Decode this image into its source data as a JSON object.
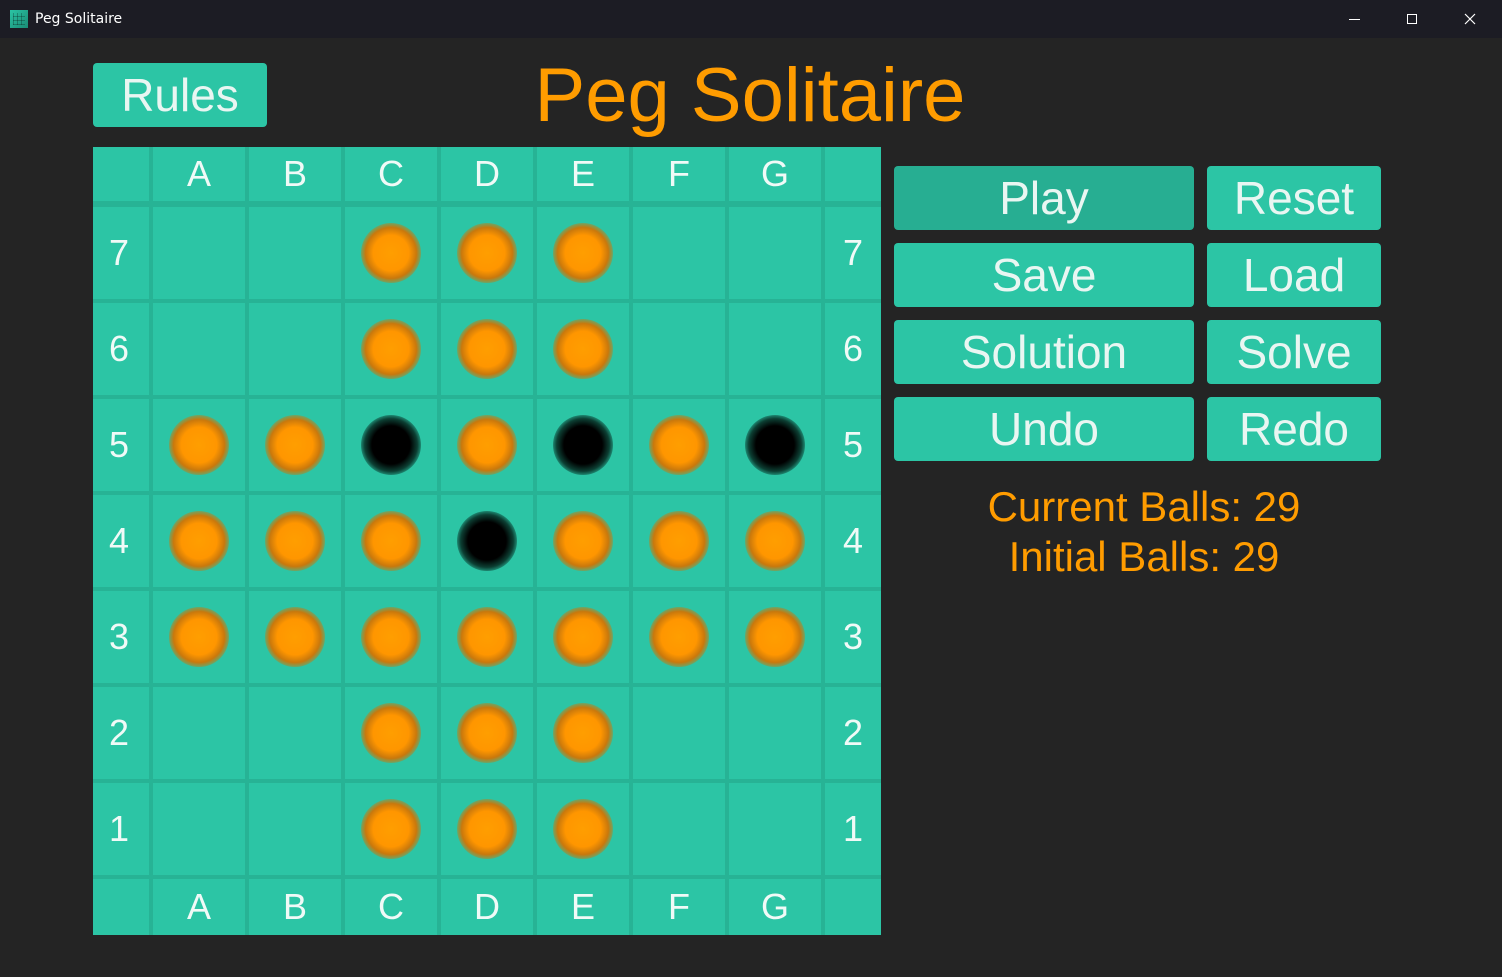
{
  "window": {
    "title": "Peg Solitaire",
    "controls": [
      "minimize-icon",
      "maximize-icon",
      "close-icon"
    ]
  },
  "header": {
    "rules_label": "Rules",
    "title": "Peg Solitaire"
  },
  "board": {
    "columns": [
      "A",
      "B",
      "C",
      "D",
      "E",
      "F",
      "G"
    ],
    "rows": [
      "7",
      "6",
      "5",
      "4",
      "3",
      "2",
      "1"
    ],
    "cells": [
      [
        null,
        null,
        "peg",
        "peg",
        "peg",
        null,
        null
      ],
      [
        null,
        null,
        "peg",
        "peg",
        "peg",
        null,
        null
      ],
      [
        "peg",
        "peg",
        "hole",
        "peg",
        "hole",
        "peg",
        "hole"
      ],
      [
        "peg",
        "peg",
        "peg",
        "hole",
        "peg",
        "peg",
        "peg"
      ],
      [
        "peg",
        "peg",
        "peg",
        "peg",
        "peg",
        "peg",
        "peg"
      ],
      [
        null,
        null,
        "peg",
        "peg",
        "peg",
        null,
        null
      ],
      [
        null,
        null,
        "peg",
        "peg",
        "peg",
        null,
        null
      ]
    ]
  },
  "controls": {
    "play": "Play",
    "reset": "Reset",
    "save": "Save",
    "load": "Load",
    "solution": "Solution",
    "solve": "Solve",
    "undo": "Undo",
    "redo": "Redo"
  },
  "stats": {
    "current": "Current Balls: 29",
    "initial": "Initial Balls: 29"
  },
  "colors": {
    "accent": "#ff9c00",
    "teal": "#2cc5a5",
    "teal_dark": "#27b395",
    "background": "#242424"
  }
}
